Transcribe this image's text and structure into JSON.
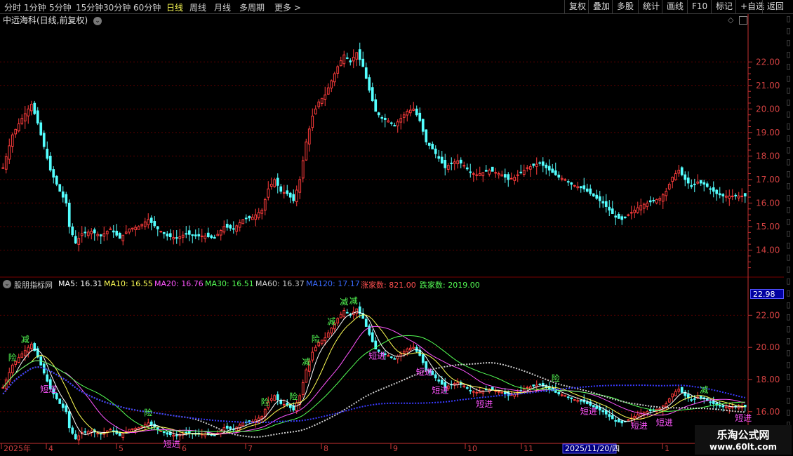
{
  "toolbar": {
    "periods": [
      "分时",
      "1分钟",
      "5分钟",
      "15分钟",
      "30分钟",
      "60分钟",
      "日线",
      "周线",
      "月线",
      "多周期",
      "更多 >"
    ],
    "active_period": "日线",
    "right_buttons": [
      "复权",
      "叠加",
      "多股",
      "统计",
      "画线",
      "F10",
      "标记",
      "+自选",
      "返回"
    ]
  },
  "main_title": "中远海科(日线,前复权)",
  "indicator": {
    "name": "股朋指标网",
    "ma5": "MA5: 16.31",
    "ma10": "MA10: 16.55",
    "ma20": "MA20: 16.76",
    "ma30": "MA30: 16.51",
    "ma60": "MA60: 16.37",
    "ma120": "MA120: 17.17",
    "rise_count": "涨家数: 821.00",
    "fall_count": "跌家数: 2019.00",
    "current_value": "22.98"
  },
  "colors": {
    "up": "#ff3c3c",
    "down": "#54ffff",
    "grid": "#5a0000",
    "axis": "#c83232",
    "ma5": "#ffffff",
    "ma10": "#ffff55",
    "ma20": "#ff55ff",
    "ma30": "#55ff55",
    "ma60": "#cccccc",
    "ma120": "#3a3aff",
    "rise": "#ff5050",
    "fall": "#55ff55"
  },
  "date_axis": {
    "labels": [
      "2025年",
      "4",
      "5",
      "6",
      "7",
      "8",
      "9",
      "10",
      "11",
      "2025/11/20/四",
      "1"
    ],
    "highlight": "2025/11/20/四"
  },
  "watermark": {
    "line1": "乐淘公式网",
    "line2": "www.60lt.com"
  },
  "chart_data": [
    {
      "type": "candlestick",
      "title": "中远海科(日线,前复权)",
      "y_ticks": [
        14.0,
        15.0,
        16.0,
        17.0,
        18.0,
        19.0,
        20.0,
        21.0,
        22.0
      ],
      "ylim": [
        13.0,
        23.5
      ],
      "close_path": [
        [
          0,
          17.5
        ],
        [
          3,
          18.9
        ],
        [
          6,
          19.6
        ],
        [
          9,
          20.2
        ],
        [
          11,
          19.4
        ],
        [
          13,
          18.4
        ],
        [
          15,
          17.4
        ],
        [
          18,
          16.5
        ],
        [
          20,
          16.0
        ],
        [
          21,
          15.0
        ],
        [
          23,
          14.3
        ],
        [
          25,
          14.7
        ],
        [
          28,
          14.8
        ],
        [
          31,
          14.6
        ],
        [
          34,
          14.9
        ],
        [
          37,
          14.5
        ],
        [
          40,
          14.9
        ],
        [
          43,
          15.0
        ],
        [
          46,
          15.3
        ],
        [
          49,
          14.9
        ],
        [
          52,
          14.6
        ],
        [
          55,
          14.5
        ],
        [
          58,
          14.7
        ],
        [
          61,
          14.6
        ],
        [
          64,
          14.6
        ],
        [
          67,
          14.5
        ],
        [
          70,
          15.0
        ],
        [
          73,
          14.9
        ],
        [
          76,
          15.3
        ],
        [
          79,
          15.4
        ],
        [
          82,
          15.7
        ],
        [
          84,
          16.6
        ],
        [
          86,
          17.0
        ],
        [
          88,
          16.5
        ],
        [
          90,
          16.4
        ],
        [
          92,
          16.1
        ],
        [
          94,
          17.0
        ],
        [
          96,
          18.6
        ],
        [
          98,
          19.7
        ],
        [
          100,
          20.3
        ],
        [
          102,
          20.6
        ],
        [
          104,
          21.2
        ],
        [
          106,
          21.8
        ],
        [
          108,
          22.3
        ],
        [
          110,
          22.0
        ],
        [
          112,
          22.4
        ],
        [
          114,
          21.8
        ],
        [
          116,
          20.8
        ],
        [
          118,
          19.9
        ],
        [
          120,
          19.6
        ],
        [
          122,
          19.5
        ],
        [
          124,
          19.3
        ],
        [
          126,
          19.6
        ],
        [
          128,
          19.9
        ],
        [
          130,
          20.0
        ],
        [
          132,
          19.5
        ],
        [
          134,
          18.6
        ],
        [
          136,
          18.3
        ],
        [
          138,
          17.9
        ],
        [
          140,
          17.5
        ],
        [
          142,
          17.7
        ],
        [
          144,
          17.8
        ],
        [
          146,
          17.6
        ],
        [
          148,
          17.3
        ],
        [
          150,
          17.2
        ],
        [
          152,
          17.3
        ],
        [
          154,
          17.4
        ],
        [
          156,
          17.3
        ],
        [
          158,
          17.2
        ],
        [
          160,
          17.0
        ],
        [
          162,
          17.1
        ],
        [
          164,
          17.3
        ],
        [
          166,
          17.5
        ],
        [
          168,
          17.6
        ],
        [
          170,
          17.7
        ],
        [
          172,
          17.5
        ],
        [
          174,
          17.3
        ],
        [
          176,
          17.1
        ],
        [
          178,
          17.0
        ],
        [
          180,
          16.8
        ],
        [
          182,
          16.7
        ],
        [
          184,
          16.6
        ],
        [
          186,
          16.4
        ],
        [
          188,
          16.2
        ],
        [
          190,
          16.0
        ],
        [
          192,
          15.7
        ],
        [
          194,
          15.4
        ],
        [
          196,
          15.3
        ],
        [
          198,
          15.5
        ],
        [
          200,
          15.7
        ],
        [
          202,
          15.9
        ],
        [
          204,
          16.0
        ],
        [
          206,
          16.1
        ],
        [
          208,
          16.2
        ],
        [
          210,
          16.5
        ],
        [
          212,
          17.1
        ],
        [
          214,
          17.4
        ],
        [
          216,
          17.0
        ],
        [
          218,
          16.7
        ],
        [
          220,
          16.9
        ],
        [
          222,
          16.8
        ],
        [
          224,
          16.6
        ],
        [
          226,
          16.4
        ],
        [
          228,
          16.3
        ]
      ]
    },
    {
      "type": "line",
      "title": "股朋指标网",
      "y_ticks": [
        16.0,
        18.0,
        20.0,
        22.0
      ],
      "ylim": [
        14.2,
        23.5
      ],
      "series": [
        {
          "name": "MA5",
          "values_of": "close_smoothed_5"
        },
        {
          "name": "MA10",
          "values_of": "close_smoothed_10"
        },
        {
          "name": "MA20",
          "values_of": "close_smoothed_20"
        },
        {
          "name": "MA30",
          "values_of": "close_smoothed_30"
        },
        {
          "name": "MA60",
          "values_of": "close_smoothed_60"
        },
        {
          "name": "MA120",
          "values_of": "close_smoothed_120"
        }
      ],
      "signals": [
        {
          "bar": 3,
          "text": "险",
          "color": "#55ff55"
        },
        {
          "bar": 7,
          "text": "减",
          "color": "#55ff55"
        },
        {
          "bar": 14,
          "text": "短进",
          "color": "#ff55ff"
        },
        {
          "bar": 46,
          "text": "险",
          "color": "#55ff55"
        },
        {
          "bar": 53,
          "text": "短进",
          "color": "#ff55ff"
        },
        {
          "bar": 83,
          "text": "险",
          "color": "#55ff55"
        },
        {
          "bar": 92,
          "text": "险",
          "color": "#55ff55"
        },
        {
          "bar": 96,
          "text": "减",
          "color": "#55ff55"
        },
        {
          "bar": 99,
          "text": "险",
          "color": "#55ff55"
        },
        {
          "bar": 104,
          "text": "减",
          "color": "#55ff55"
        },
        {
          "bar": 108,
          "text": "减",
          "color": "#55ff55"
        },
        {
          "bar": 111,
          "text": "减",
          "color": "#55ff55"
        },
        {
          "bar": 118,
          "text": "短进",
          "color": "#ff55ff"
        },
        {
          "bar": 133,
          "text": "短进",
          "color": "#ff55ff"
        },
        {
          "bar": 138,
          "text": "短进",
          "color": "#ff55ff"
        },
        {
          "bar": 152,
          "text": "短进",
          "color": "#ff55ff"
        },
        {
          "bar": 175,
          "text": "险",
          "color": "#55ff55"
        },
        {
          "bar": 185,
          "text": "短进",
          "color": "#ff55ff"
        },
        {
          "bar": 201,
          "text": "短进",
          "color": "#ff55ff"
        },
        {
          "bar": 209,
          "text": "短进",
          "color": "#ff55ff"
        },
        {
          "bar": 222,
          "text": "减",
          "color": "#55ff55"
        },
        {
          "bar": 234,
          "text": "短进",
          "color": "#ff55ff"
        }
      ]
    }
  ]
}
